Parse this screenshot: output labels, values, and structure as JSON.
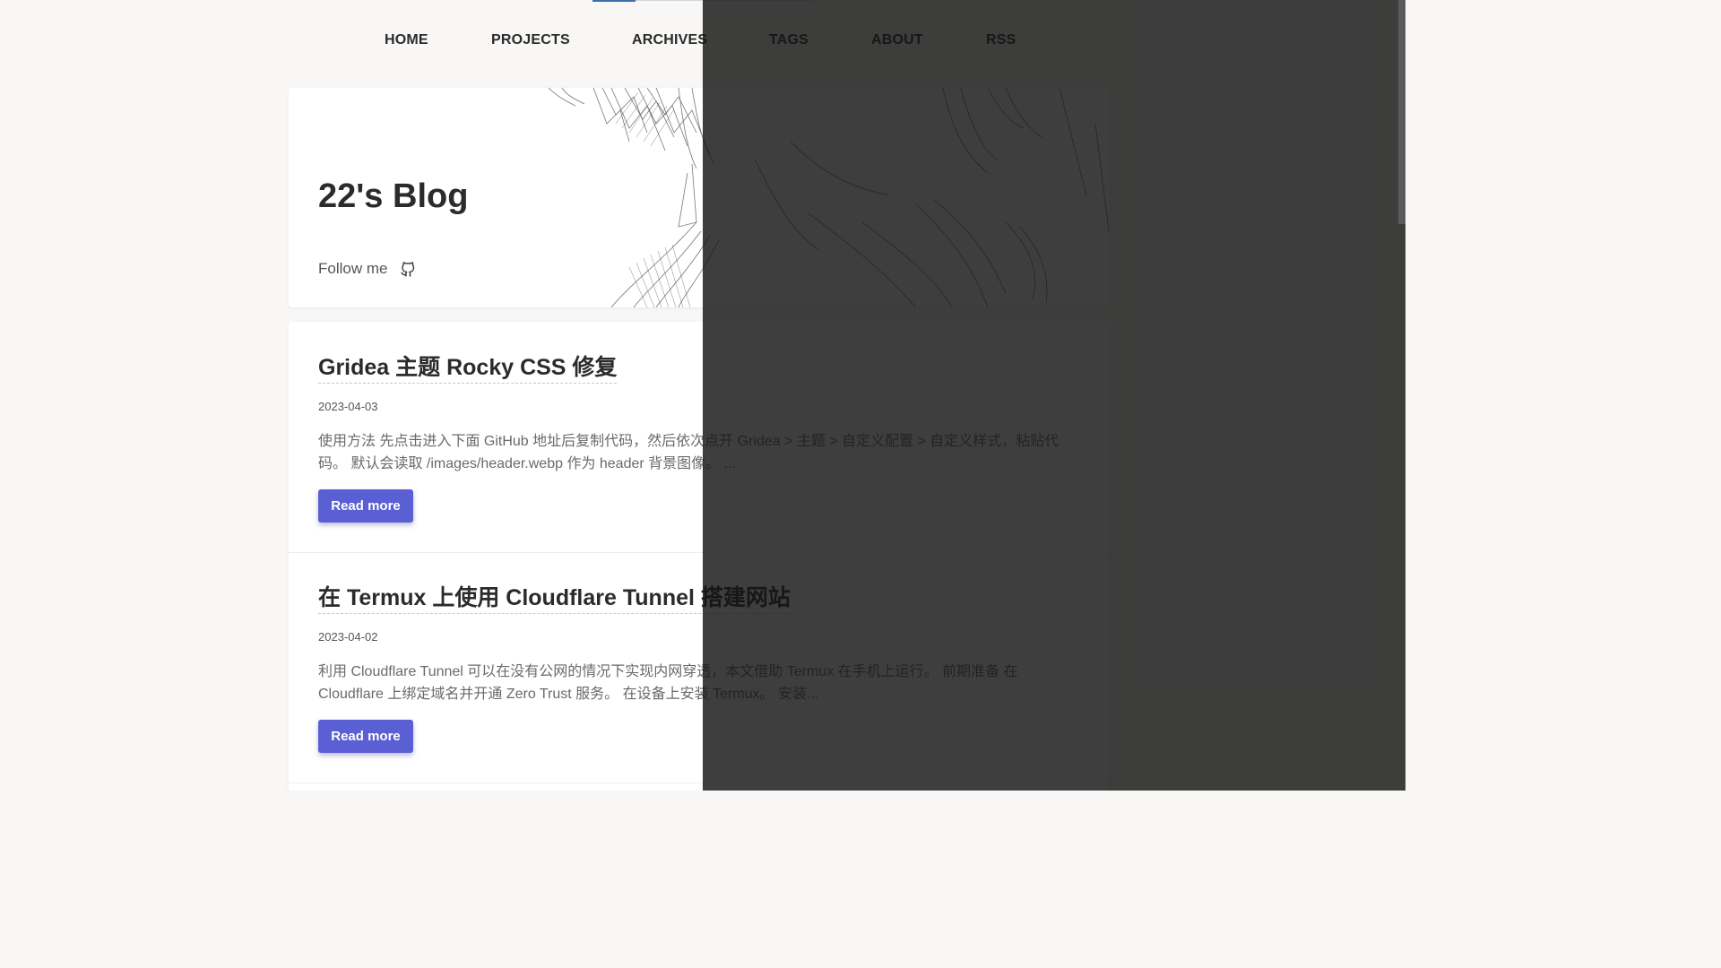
{
  "nav": {
    "items": [
      {
        "label": "HOME"
      },
      {
        "label": "PROJECTS"
      },
      {
        "label": "ARCHIVES"
      },
      {
        "label": "TAGS"
      },
      {
        "label": "ABOUT"
      },
      {
        "label": "RSS"
      }
    ]
  },
  "hero": {
    "title": "22's Blog",
    "follow_label": "Follow me",
    "social_icon": "github-icon"
  },
  "posts": [
    {
      "title": "Gridea 主题 Rocky CSS 修复",
      "date": "2023-04-03",
      "excerpt": "使用方法 先点击进入下面 GitHub 地址后复制代码，然后依次点开 Gridea > 主题 > 自定义配置 > 自定义样式，粘贴代码。 默认会读取 /images/header.webp 作为 header 背景图像。 ...",
      "button_label": "Read more"
    },
    {
      "title": "在 Termux 上使用 Cloudflare Tunnel 搭建网站",
      "date": "2023-04-02",
      "excerpt": "利用 Cloudflare Tunnel 可以在没有公网的情况下实现内网穿透，本文借助 Termux 在手机上运行。 前期准备 在 Cloudflare 上绑定域名并开通 Zero Trust 服务。 在设备上安装 Termux。 安装...",
      "button_label": "Read more"
    }
  ],
  "colors": {
    "accent": "#5a5fd4",
    "background": "#f8f7f5",
    "card": "#ffffff",
    "dark_overlay": "#2e2e2e"
  }
}
